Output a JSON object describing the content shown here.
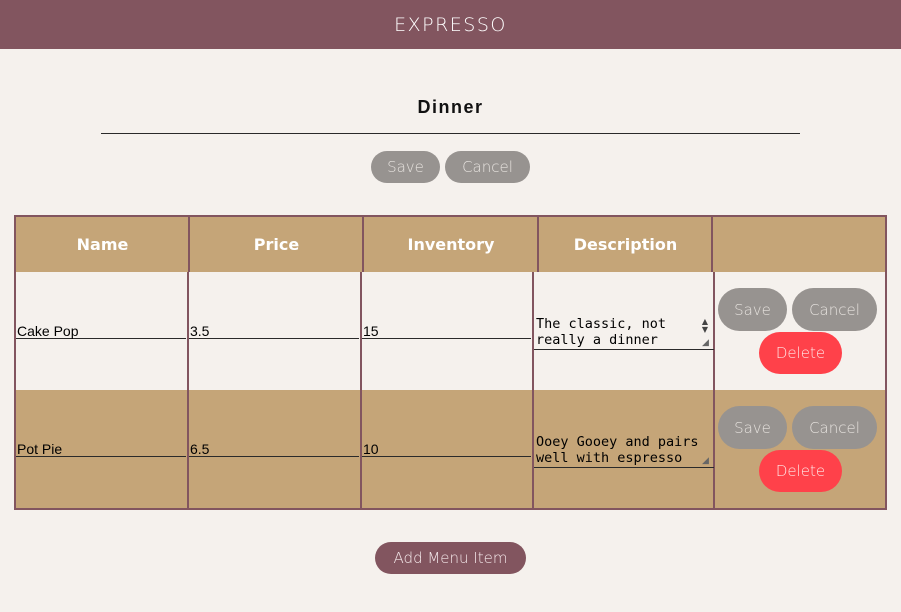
{
  "header": {
    "logo": "EXPRESSO"
  },
  "menu": {
    "title": "Dinner",
    "save_label": "Save",
    "cancel_label": "Cancel"
  },
  "table": {
    "columns": [
      "Name",
      "Price",
      "Inventory",
      "Description",
      ""
    ],
    "rows": [
      {
        "name": "Cake Pop",
        "price": "3.5",
        "inventory": "15",
        "description": "The classic, not really a dinner",
        "save_label": "Save",
        "cancel_label": "Cancel",
        "delete_label": "Delete"
      },
      {
        "name": "Pot Pie",
        "price": "6.5",
        "inventory": "10",
        "description": "Ooey Gooey and pairs well with espresso",
        "save_label": "Save",
        "cancel_label": "Cancel",
        "delete_label": "Delete"
      }
    ]
  },
  "footer": {
    "add_label": "Add Menu Item"
  },
  "colors": {
    "header_bg": "#82555f",
    "page_bg": "#f5f1ed",
    "table_header_bg": "#c5a578",
    "grey_button": "#979390",
    "delete_button": "#ff414a"
  }
}
